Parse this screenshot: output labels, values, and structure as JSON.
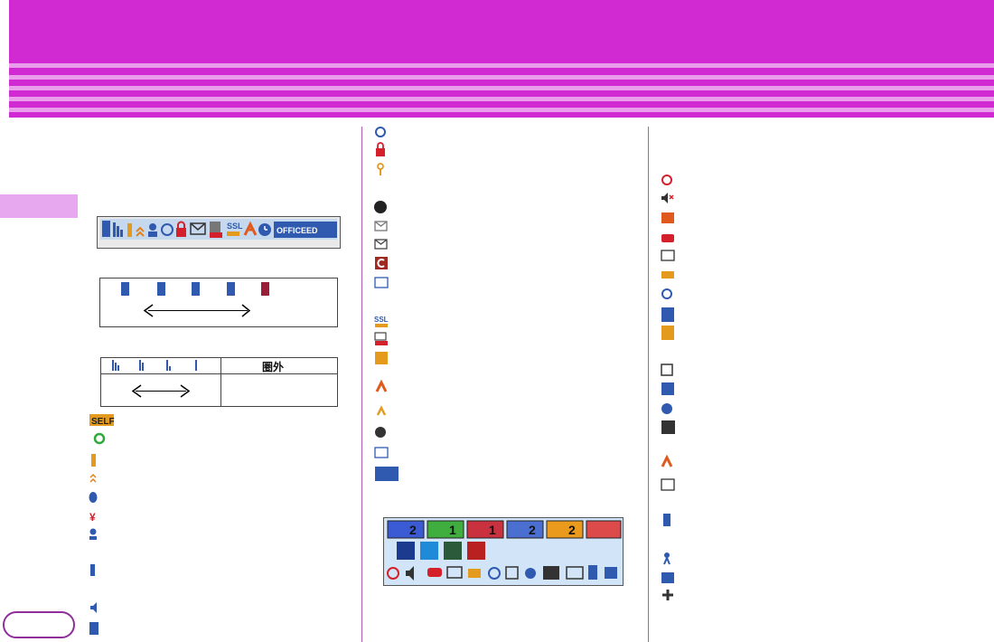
{
  "page": {
    "out_of_range_label": "圏外"
  },
  "statusbar_badges": [
    {
      "icon": "phone-icon",
      "count": "2",
      "color": "#3a5bd4"
    },
    {
      "icon": "message-icon",
      "count": "1",
      "color": "#3fae3f"
    },
    {
      "icon": "fax-icon",
      "count": "1",
      "color": "#c9313e"
    },
    {
      "icon": "mail-icon",
      "count": "2",
      "color": "#4a6fd0"
    },
    {
      "icon": "pen-icon",
      "count": "2",
      "color": "#ea9a1c"
    }
  ],
  "icon_sets": {
    "left_column": [
      "self-mode-icon",
      "sync-icon",
      "i-appli-icon",
      "up-arrows-icon",
      "bluetooth-icon",
      "yen-icon",
      "person-connect-icon",
      "phone-signal-icon",
      "speaker-icon",
      "memory-icon"
    ],
    "middle_column": [
      "satellite-icon",
      "lock-icon",
      "key-icon",
      "record-dot-icon",
      "new-mail-icon",
      "mail-icon",
      "c-app-icon",
      "keyboard-icon",
      "ssl-icon",
      "auto-mail-icon",
      "grid-icon",
      "toruca-icon",
      "toruca-send-icon",
      "clock-icon",
      "keyboard-icon",
      "officeed-icon"
    ],
    "right_column": [
      "heart-icon",
      "mute-icon",
      "vibrate-icon",
      "car-icon",
      "radio-icon",
      "key-lock-icon",
      "satellite-off-icon",
      "face-key-icon",
      "grid-lock-icon",
      "card-icon",
      "ic-key-icon",
      "navi-icon",
      "screen-rec-icon",
      "toruca-off-icon",
      "sd-card-icon",
      "usb-icon",
      "walker-icon",
      "phone-forward-icon",
      "cross-icon"
    ]
  },
  "colors": {
    "header": "#d22ad2",
    "header_stripe": "#ea9dea",
    "side_tab": "#e8a8ef",
    "accent": "#8e2f9a"
  }
}
